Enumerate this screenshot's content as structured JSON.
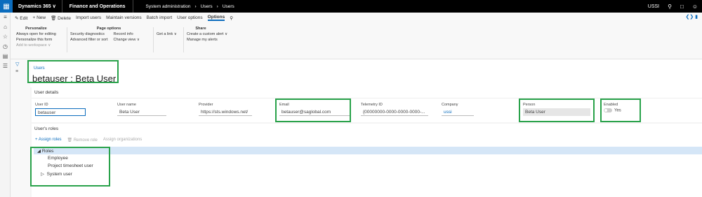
{
  "topbar": {
    "app": "Dynamics 365",
    "module": "Finance and Operations",
    "crumbs": [
      "System administration",
      "Users",
      "Users"
    ],
    "company": "USSI"
  },
  "actionbar": {
    "items": [
      "Edit",
      "New",
      "Delete",
      "Import users",
      "Maintain versions",
      "Batch import",
      "User options",
      "Options"
    ],
    "selected": "Options"
  },
  "ribbon": {
    "personalize": {
      "title": "Personalize",
      "items": [
        "Always open for editing",
        "Personalize this form",
        "Add to workspace"
      ]
    },
    "page_options": {
      "title": "Page options",
      "col1": [
        "Security diagnostics",
        "Advanced filter or sort"
      ],
      "col2": [
        "Record info",
        "Change view"
      ]
    },
    "get_link": "Get a link",
    "share": {
      "title": "Share",
      "items": [
        "Create a custom alert",
        "Manage my alerts"
      ]
    }
  },
  "header": {
    "link": "Users",
    "title": "betauser : Beta User"
  },
  "details": {
    "title": "User details",
    "fields": {
      "user_id": {
        "label": "User ID",
        "value": "betauser"
      },
      "user_name": {
        "label": "User name",
        "value": "Beta User"
      },
      "provider": {
        "label": "Provider",
        "value": "https://sts.windows.net/"
      },
      "email": {
        "label": "Email",
        "value": "betauser@saglobal.com"
      },
      "telemetry": {
        "label": "Telemetry ID",
        "value": "{00000000-0000-0000-0000-..."
      },
      "company": {
        "label": "Company",
        "value": "ussi"
      },
      "person": {
        "label": "Person",
        "value": "Beta User"
      },
      "enabled": {
        "label": "Enabled",
        "value": "Yes"
      }
    }
  },
  "roles": {
    "title": "User's roles",
    "actions": [
      "Assign roles",
      "Remove role",
      "Assign organizations"
    ],
    "tree": [
      "Roles",
      "Employee",
      "Project timesheet user",
      "System user"
    ]
  }
}
